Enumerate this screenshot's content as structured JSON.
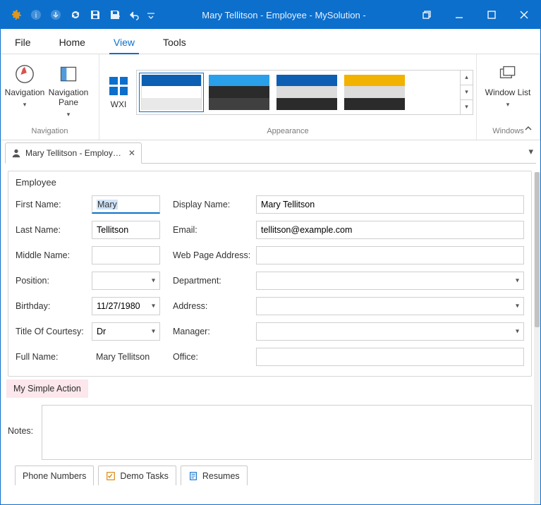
{
  "window": {
    "title": "Mary Tellitson - Employee - MySolution -"
  },
  "menubar": {
    "items": [
      {
        "label": "File"
      },
      {
        "label": "Home"
      },
      {
        "label": "View",
        "active": true
      },
      {
        "label": "Tools"
      }
    ]
  },
  "ribbon": {
    "groups": {
      "navigation": {
        "caption": "Navigation",
        "buttons": {
          "nav": "Navigation",
          "pane": "Navigation Pane"
        }
      },
      "wxi": {
        "label": "WXI"
      },
      "appearance": {
        "caption": "Appearance",
        "themes": [
          {
            "c1": "#0c5fb3",
            "c2": "#ffffff",
            "c3": "#e9e9e9",
            "selected": true
          },
          {
            "c1": "#2aa0ea",
            "c2": "#2b2b2b",
            "c3": "#404040"
          },
          {
            "c1": "#0c5fb3",
            "c2": "#dcdcdc",
            "c3": "#2b2b2b"
          },
          {
            "c1": "#f2b200",
            "c2": "#dcdcdc",
            "c3": "#2b2b2b"
          }
        ]
      },
      "windows": {
        "caption": "Windows",
        "button": "Window List"
      }
    }
  },
  "doc_tab": {
    "label": "Mary Tellitson - Employ…"
  },
  "form": {
    "group_title": "Employee",
    "labels": {
      "first_name": "First Name:",
      "last_name": "Last Name:",
      "middle_name": "Middle Name:",
      "position": "Position:",
      "birthday": "Birthday:",
      "title_of_courtesy": "Title Of Courtesy:",
      "full_name": "Full Name:",
      "display_name": "Display Name:",
      "email": "Email:",
      "web": "Web Page Address:",
      "department": "Department:",
      "address": "Address:",
      "manager": "Manager:",
      "office": "Office:",
      "notes": "Notes:"
    },
    "values": {
      "first_name": "Mary",
      "last_name": "Tellitson",
      "middle_name": "",
      "position": "",
      "birthday": "11/27/1980",
      "title_of_courtesy": "Dr",
      "full_name": "Mary Tellitson",
      "display_name": "Mary Tellitson",
      "email": "tellitson@example.com",
      "web": "",
      "department": "",
      "address": "",
      "manager": "",
      "office": "",
      "notes": ""
    },
    "action": "My Simple Action"
  },
  "bottom_tabs": {
    "phone": "Phone Numbers",
    "demo": "Demo Tasks",
    "resumes": "Resumes"
  }
}
